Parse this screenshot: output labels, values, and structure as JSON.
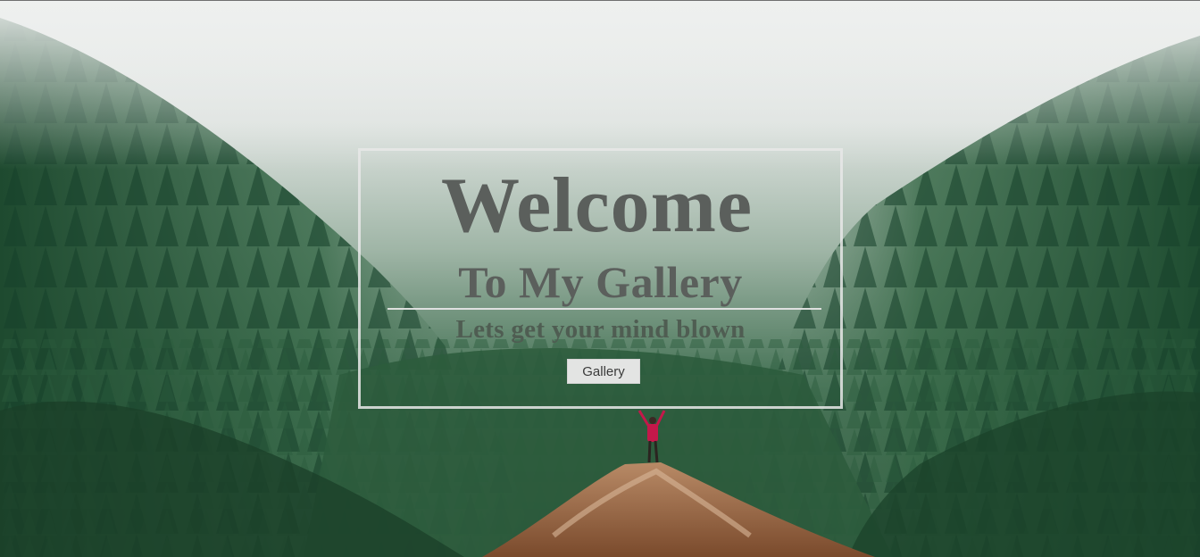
{
  "hero": {
    "title": "Welcome",
    "subtitle": "To My Gallery",
    "tagline": "Lets get your mind blown",
    "button_label": "Gallery"
  },
  "colors": {
    "title_text": "#5b5f5c",
    "box_border": "#e8e8e8",
    "button_bg": "#e3e4e3",
    "forest_dark": "#1f4a2f",
    "fog": "#e4e6e5",
    "hiker_jacket": "#c4184a"
  }
}
